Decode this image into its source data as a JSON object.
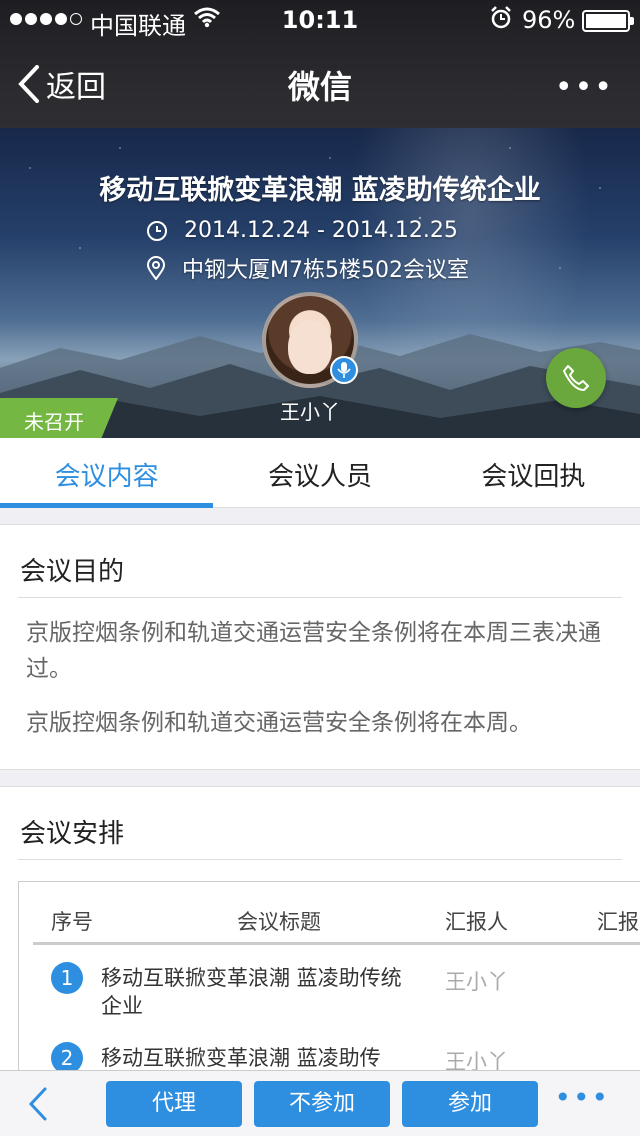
{
  "status_bar": {
    "carrier": "中国联通",
    "time": "10:11",
    "battery": "96%"
  },
  "nav": {
    "back_label": "返回",
    "title": "微信",
    "more_label": "•••"
  },
  "meeting": {
    "title": "移动互联掀变革浪潮 蓝凌助传统企业",
    "date_range": "2014.12.24 - 2014.12.25",
    "location": "中钢大厦M7栋5楼502会议室",
    "host_name": "王小丫",
    "status": "未召开"
  },
  "tabs": [
    {
      "label": "会议内容",
      "active": true
    },
    {
      "label": "会议人员",
      "active": false
    },
    {
      "label": "会议回执",
      "active": false
    }
  ],
  "purpose": {
    "heading": "会议目的",
    "paragraphs": [
      "京版控烟条例和轨道交通运营安全条例将在本周三表决通过。",
      "京版控烟条例和轨道交通运营安全条例将在本周。"
    ]
  },
  "agenda": {
    "heading": "会议安排",
    "columns": [
      "序号",
      "会议标题",
      "汇报人",
      "汇报"
    ],
    "rows": [
      {
        "num": "1",
        "title": "移动互联掀变革浪潮 蓝凌助传统企业",
        "reporter": "王小丫"
      },
      {
        "num": "2",
        "title": "移动互联掀变革浪潮 蓝凌助传",
        "reporter": "王小丫"
      }
    ]
  },
  "actions": {
    "proxy": "代理",
    "decline": "不参加",
    "join": "参加",
    "more": "•••"
  },
  "colors": {
    "accent": "#2e8fe0",
    "status_green": "#74b843"
  }
}
